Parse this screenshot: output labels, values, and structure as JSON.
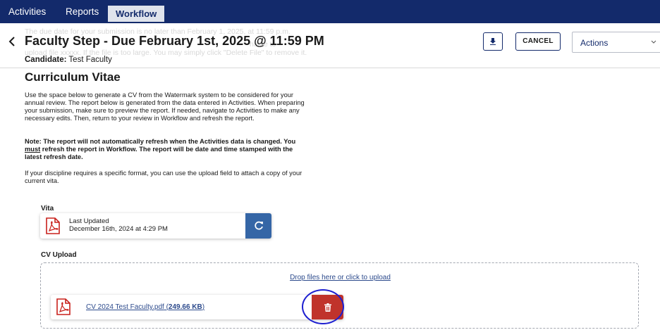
{
  "nav": {
    "items": [
      {
        "label": "Activities"
      },
      {
        "label": "Reports"
      },
      {
        "label": "Workflow",
        "active": true
      }
    ]
  },
  "header": {
    "ghost_line_1": "The due date for your submission is no later than February 1, 2025, at 11:59 p.m.",
    "ghost_line_2": "upload file xxxxx. If the file is too large. You may simply click \"Delete File\" to remove it.",
    "ghost_fragment": "nable to",
    "title": "Faculty Step - Due February 1st, 2025 @ 11:59 PM",
    "candidate_label": "Candidate:",
    "candidate_name": "Test Faculty",
    "cancel_label": "CANCEL",
    "actions_label": "Actions",
    "download_icon": "download-icon"
  },
  "content": {
    "heading": "Curriculum Vitae",
    "para1": "Use the space below to generate a CV from the Watermark system to be considered for your annual review. The report below is generated from the data entered in Activities. When preparing your submission, make sure to preview the report. If needed, navigate to Activities to make any necessary edits. Then, return to your review in Workflow and refresh the report.",
    "note_part1": "Note: The report will not automatically refresh when the Activities data is changed. You ",
    "note_must": "must",
    "note_part2": " refresh the report in Workflow. The report will be date and time stamped with the latest refresh date.",
    "para3": "If your discipline requires a specific format, you can use the upload field to attach a copy of your current vita."
  },
  "vita": {
    "label": "Vita",
    "last_updated_label": "Last Updated",
    "last_updated_value": "December 16th, 2024 at 4:29 PM"
  },
  "cv_upload": {
    "label": "CV Upload",
    "drop_text": "Drop files here or click to upload",
    "file_name": "CV 2024 Test Faculty.pdf",
    "file_size": "249.66 KB"
  },
  "colors": {
    "nav_bg": "#132a6b",
    "refresh": "#3566a6",
    "delete": "#c0332b",
    "pdf_red": "#c8211c",
    "link": "#2c4a8c",
    "highlight_ring": "#1d1fd0"
  }
}
